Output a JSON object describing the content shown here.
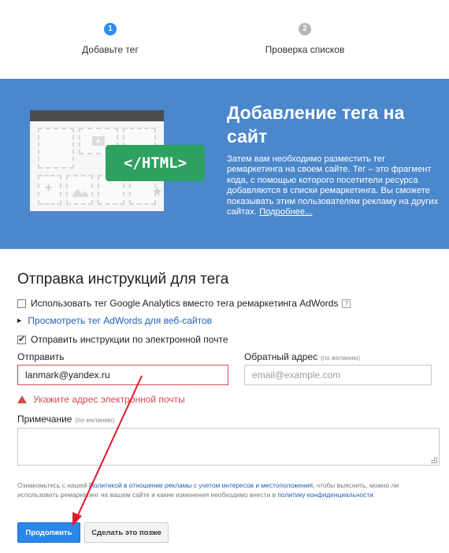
{
  "stepper": {
    "steps": [
      {
        "number": "1",
        "label": "Добавьте тег",
        "state": "active"
      },
      {
        "number": "2",
        "label": "Проверка списков",
        "state": "inactive"
      }
    ]
  },
  "banner": {
    "illustration_badge": "</HTML>",
    "title": "Добавление тега на сайт",
    "text": "Затем вам необходимо разместить тег ремаркетинга на своем сайте. Тег – это фрагмент кода, с помощью которого посетители ресурса добавляются в списки ремаркетинга. Вы сможете показывать этим пользователям рекламу на других сайтах.",
    "more_link": "Подробнее..."
  },
  "form": {
    "section_title": "Отправка инструкций для тега",
    "use_ga_checkbox": {
      "label": "Использовать тег Google Analytics вместо тега ремаркетинга AdWords",
      "checked": false,
      "help": "?"
    },
    "view_tag_link": "Просмотреть тег AdWords для веб-сайтов",
    "send_email_checkbox": {
      "label": "Отправить инструкции по электронной почте",
      "checked": true
    },
    "send_to": {
      "label": "Отправить",
      "value": "lanmark@yandex.ru"
    },
    "reply_to": {
      "label": "Обратный адрес",
      "optional": "(по желанию)",
      "placeholder": "email@example.com"
    },
    "error": "Укажите адрес электронной почты",
    "note": {
      "label": "Примечание",
      "optional": "(по желанию)",
      "value": ""
    },
    "footnote": {
      "part1": "Ознакомьтесь с нашей ",
      "link1": "Политикой в отношении рекламы с учетом интересов и местоположения",
      "part2": ", чтобы выяснить, можно ли использовать ремаркетинг на вашем сайте и какие изменения необходимо внести в ",
      "link2": "политику конфиденциальности",
      "part3": "."
    }
  },
  "buttons": {
    "continue": "Продолжить",
    "later": "Сделать это позже"
  },
  "colors": {
    "banner_bg": "#4b87cb",
    "badge_green": "#2da15f",
    "primary_blue": "#2b86ea",
    "error_red": "#d24b4b",
    "annotation_arrow": "#e0192a"
  }
}
